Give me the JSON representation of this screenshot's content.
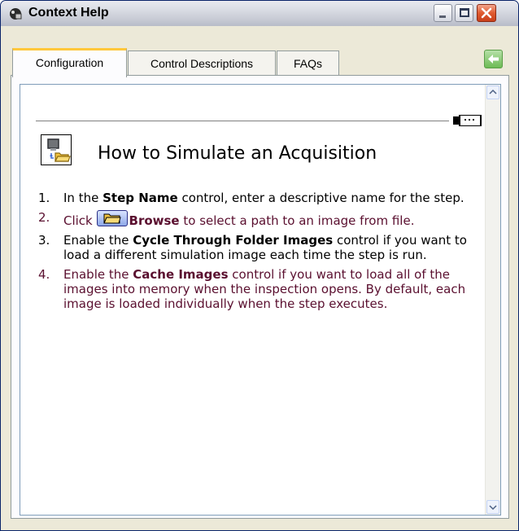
{
  "window": {
    "title": "Context Help",
    "title_icon": "context-help-app-icon",
    "buttons": [
      "minimize-icon",
      "maximize-icon",
      "close-icon"
    ]
  },
  "tabs": [
    {
      "label": "Configuration",
      "active": true
    },
    {
      "label": "Control Descriptions",
      "active": false
    },
    {
      "label": "FAQs",
      "active": false
    }
  ],
  "back_icon": "back-arrow-icon",
  "heading": {
    "icon": "simulate-acquisition-icon",
    "text": "How to Simulate an Acquisition"
  },
  "steps": [
    {
      "number": "1.",
      "before": "In the ",
      "bold": "Step Name",
      "after": " control, enter a descriptive name for the step."
    },
    {
      "number": "2.",
      "before": "Click ",
      "icon": "browse-folder-icon",
      "bold": "Browse",
      "after": " to select a path to an image from file."
    },
    {
      "number": "3.",
      "before": "Enable the ",
      "bold": "Cycle Through Folder Images",
      "after": " control if you want to load a different simulation image each time the step is run."
    },
    {
      "number": "4.",
      "before": "Enable the ",
      "bold": "Cache Images",
      "after": " control if you want to load all of the images into memory when the inspection opens. By default, each image is loaded individually when the step executes."
    }
  ],
  "colors": {
    "alt_step_text": "#5a0f2f",
    "active_tab_accent": "#ffc83c",
    "close_button": "#e05a2f"
  }
}
